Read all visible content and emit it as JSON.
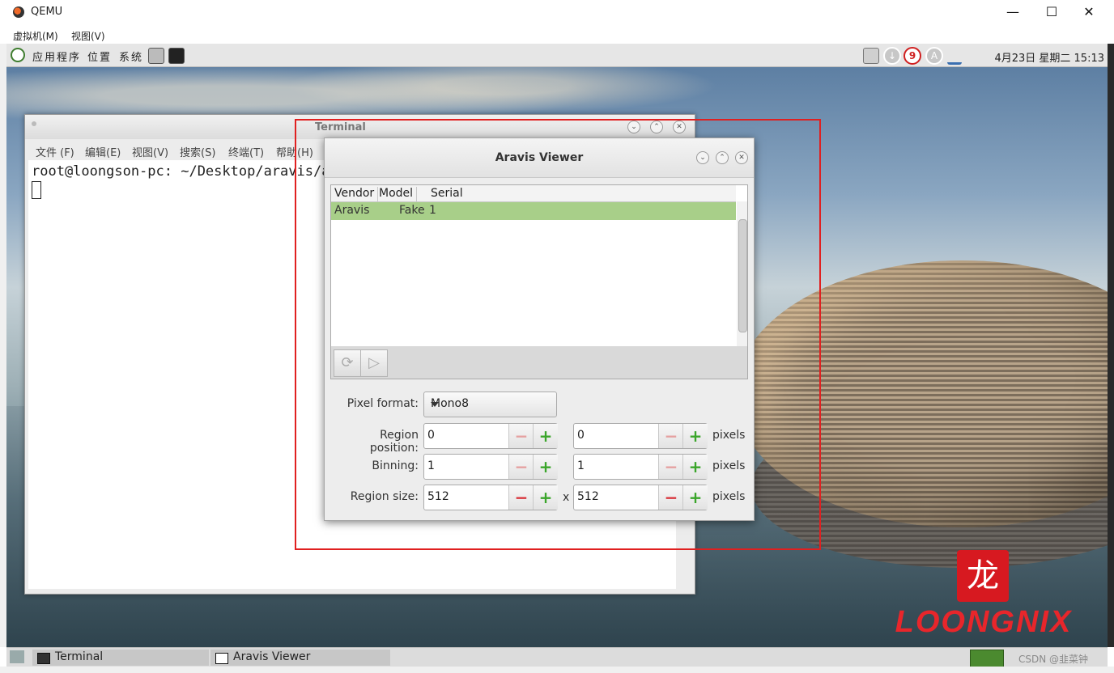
{
  "host": {
    "title": "QEMU",
    "menu": [
      "虚拟机(M)",
      "视图(V)"
    ],
    "minimize": "—",
    "maximize": "☐",
    "close": "✕"
  },
  "guest_panel": {
    "menus": [
      "应用程序",
      "位置",
      "系统"
    ],
    "notify_count": "9",
    "accessibility_letter": "A",
    "clock": "4月23日 星期二 15:13"
  },
  "terminal": {
    "title": "Terminal",
    "menu": [
      "文件 (F)",
      "编辑(E)",
      "视图(V)",
      "搜索(S)",
      "终端(T)",
      "帮助(H)"
    ],
    "prompt": "root@loongson-pc: ~/Desktop/aravis/ara"
  },
  "aravis": {
    "title": "Aravis Viewer",
    "columns": [
      "Vendor",
      "Model",
      "Serial"
    ],
    "row": {
      "vendor": "Aravis",
      "model": "Fake",
      "serial": "1"
    },
    "pixel_format_label": "Pixel format:",
    "pixel_format_value": "Mono8",
    "region_position_label": "Region position:",
    "binning_label": "Binning:",
    "region_size_label": "Region size:",
    "pos_x": "0",
    "pos_y": "0",
    "bin_x": "1",
    "bin_y": "1",
    "size_x": "512",
    "size_y": "512",
    "units": "pixels",
    "times": "x",
    "minus": "−",
    "plus": "+"
  },
  "brand": {
    "seal": "龙",
    "word": "LOONGNIX"
  },
  "taskbar": {
    "items": [
      "Terminal",
      "Aravis Viewer"
    ]
  },
  "watermark": "CSDN @韭菜钟"
}
